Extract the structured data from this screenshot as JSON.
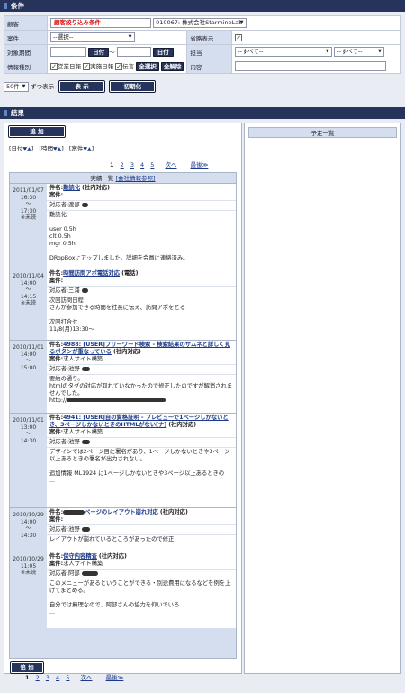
{
  "conditions": {
    "section_title": "条件",
    "customer": {
      "label": "顧客",
      "narrow_label": "顧客絞り込み条件",
      "selected": "010067: 株式会社StarmineLab"
    },
    "project": {
      "label": "案件",
      "selected": "--選択--"
    },
    "omit": {
      "label": "省略表示",
      "checked": true
    },
    "period": {
      "label": "対象期間",
      "date_button": "日付",
      "tilde": "〜"
    },
    "assignee": {
      "label": "担当",
      "select1": "--すべて--",
      "select2": "--すべて--"
    },
    "info_type": {
      "label": "情報種別",
      "options": [
        {
          "label": "営業日報",
          "checked": true
        },
        {
          "label": "実施日報",
          "checked": true
        },
        {
          "label": "伝言",
          "checked": true
        }
      ],
      "select_all": "全選択",
      "clear_all": "全解除"
    },
    "content": {
      "label": "内容"
    },
    "per_page": "50件",
    "per_page_suffix": "ずつ表示",
    "show_button": "表 示",
    "reset_button": "初期化"
  },
  "results": {
    "section_title": "結果",
    "add_button": "追 加",
    "sort": {
      "date": "[日付",
      "time": "[時間",
      "project": "[案件"
    },
    "pages": [
      "1",
      "2",
      "3",
      "4",
      "5"
    ],
    "next": "次へ",
    "last": "最後≫",
    "schedule_title": "予定一覧",
    "list_title": "実績一覧",
    "company_link": "[会社情報参照]",
    "entries": [
      {
        "date": "2011/01/07",
        "start": "16:30",
        "tilde": "〜",
        "end": "17:30",
        "status": "※未読",
        "title_label": "件名:",
        "title": "難読化",
        "tag": "(社内対応)",
        "project_label": "案件:",
        "project": "",
        "person_label": "対応者:",
        "person": "渡部",
        "lines": [
          "難読化",
          "",
          "user 0.5h",
          "clt 0.5h",
          "mgr 0.5h",
          "",
          "DRopBoxにアップしました。詳細を会員に連絡済み。"
        ]
      },
      {
        "date": "2010/11/04",
        "start": "14:00",
        "tilde": "〜",
        "end": "14:15",
        "status": "※未読",
        "title_label": "件名:",
        "title": "時間訪問アポ電話対応",
        "tag": "(電話)",
        "project_label": "案件:",
        "project": "",
        "person_label": "対応者:",
        "person": "三浦",
        "lines": [
          "次回訪問日程",
          "さんが参加できる時間を社長に伝え、訪問アポをとる",
          "",
          "次回打合せ",
          "11/8(月)13:30〜"
        ]
      },
      {
        "date": "2010/11/01",
        "start": "14:00",
        "tilde": "〜",
        "end": "15:00",
        "status": "",
        "title_label": "件名:",
        "title": "4988: [USER]フリーワード検索 - 検索結果のサムネと詳しく見るボタンが重なっている",
        "tag": "(社内対応)",
        "project_label": "案件:",
        "project": "求人サイト構築",
        "person_label": "対応者:",
        "person": "池野",
        "lines": [
          "要約の通り。",
          "htmlのタグの対応が取れていなかったので修正したのですが解消されませんでした。",
          "http://"
        ]
      },
      {
        "date": "2010/11/01",
        "start": "13:00",
        "tilde": "〜",
        "end": "14:30",
        "status": "",
        "title_label": "件名:",
        "title": "4941: [USER]自の資格証明 - プレビューで1ページしかないとき、3ページしかないときのHTMLがない[ナ]",
        "tag": "(社内対応)",
        "project_label": "案件:",
        "project": "求人サイト構築",
        "person_label": "対応者:",
        "person": "池野",
        "lines": [
          "デザインでは2ページ目に署名があり、1ページしかないときや3ページ以上あるときの署名が出力されない。",
          "",
          "追加情報 ML1924 に1ページしかないときや3ページ以上あるときの",
          "..."
        ]
      },
      {
        "date": "2010/10/29",
        "start": "14:00",
        "tilde": "〜",
        "end": "14:30",
        "status": "",
        "title_label": "件名:",
        "title": "ページのレイアウト崩れ対応",
        "tag": "(社内対応)",
        "project_label": "案件:",
        "project": "",
        "person_label": "対応者:",
        "person": "池野",
        "lines": [
          "レイアウトが崩れているところがあったので修正"
        ]
      },
      {
        "date": "2010/10/29",
        "start": "11:05",
        "tilde": "",
        "end": "",
        "status": "※未読",
        "title_label": "件名:",
        "title": "保守内容精査",
        "tag": "(社内対応)",
        "project_label": "案件:",
        "project": "求人サイト構築",
        "person_label": "対応者:",
        "person": "阿部",
        "lines": [
          "このメニューがあるということができる・別途費用になるなどを例を上げてまとめる。",
          "",
          "自分では無理なので、阿部さんの協力を仰いでいる",
          "..."
        ]
      }
    ],
    "bottom_add_button": "追 加"
  }
}
